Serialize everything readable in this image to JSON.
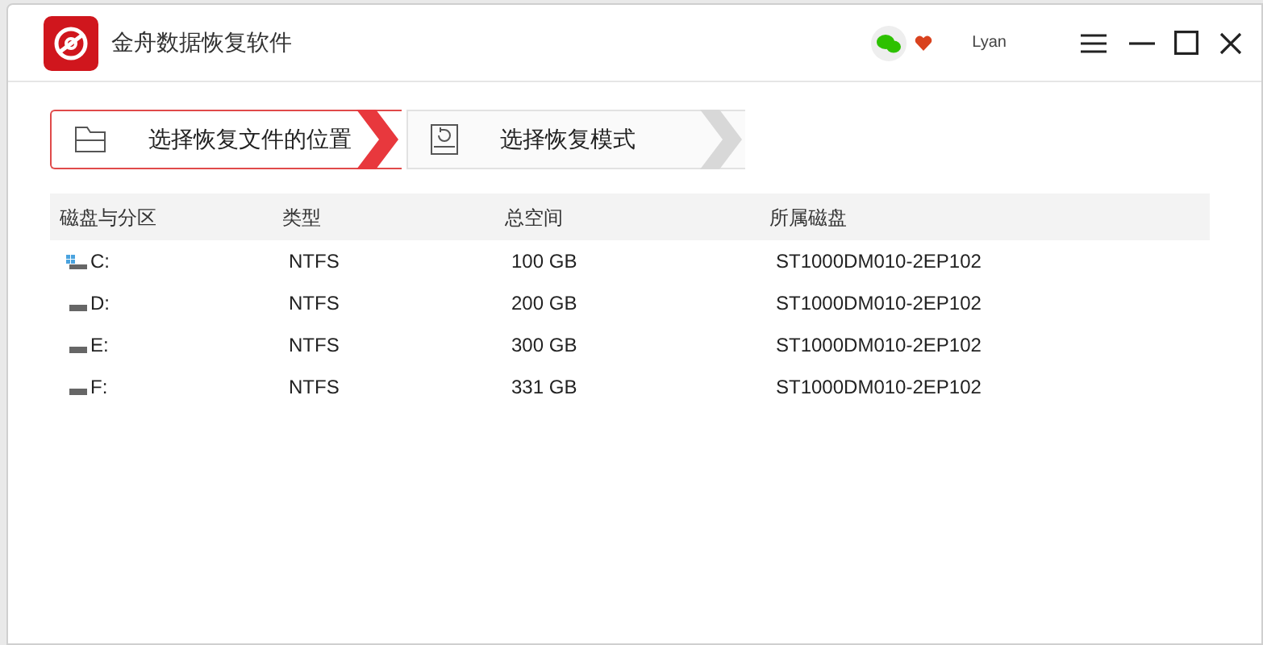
{
  "window": {
    "title": "金舟数据恢复软件",
    "user": "Lyan"
  },
  "steps": [
    {
      "label": "选择恢复文件的位置",
      "selected": true,
      "kind": "folder"
    },
    {
      "label": "选择恢复模式",
      "selected": false,
      "kind": "restore"
    }
  ],
  "table": {
    "columns": [
      "磁盘与分区",
      "类型",
      "总空间",
      "所属磁盘"
    ],
    "rows": [
      {
        "kind": "system",
        "cells": [
          "C:",
          "NTFS",
          "100 GB",
          "ST1000DM010-2EP102"
        ]
      },
      {
        "kind": "drive",
        "cells": [
          "D:",
          "NTFS",
          "200 GB",
          "ST1000DM010-2EP102"
        ]
      },
      {
        "kind": "drive",
        "cells": [
          "E:",
          "NTFS",
          "300 GB",
          "ST1000DM010-2EP102"
        ]
      },
      {
        "kind": "drive",
        "cells": [
          "F:",
          "NTFS",
          "331 GB",
          "ST1000DM010-2EP102"
        ]
      }
    ]
  }
}
